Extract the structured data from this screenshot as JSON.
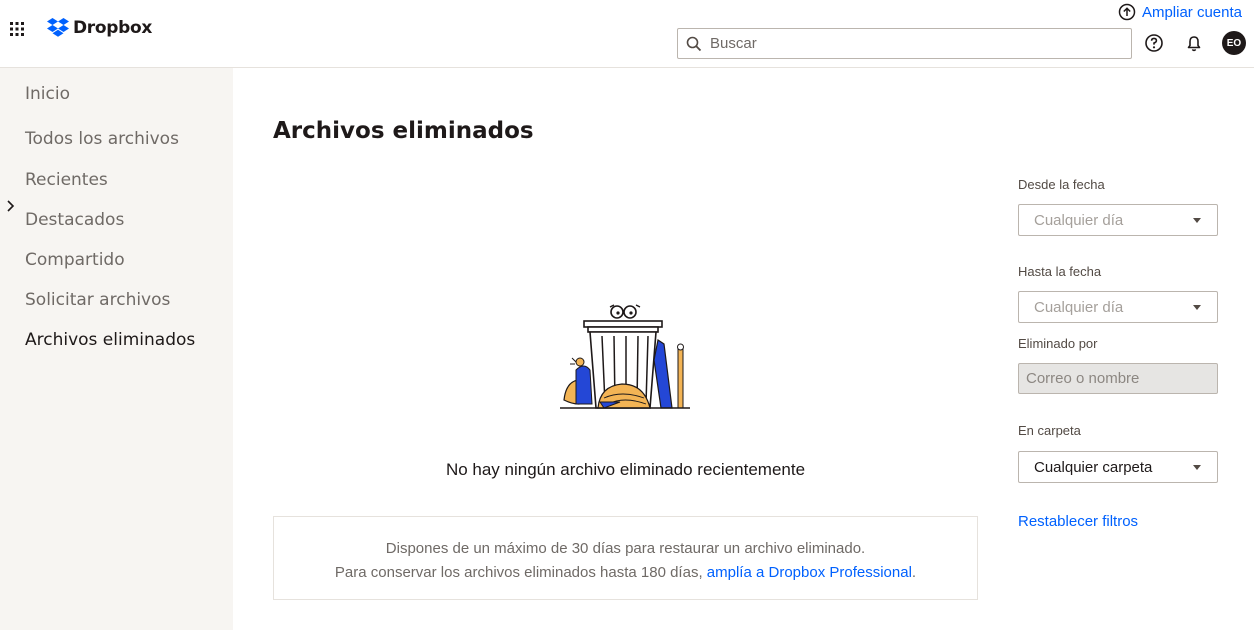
{
  "header": {
    "brand": "Dropbox",
    "upgrade_label": "Ampliar cuenta",
    "search_placeholder": "Buscar",
    "avatar_initials": "EO",
    "icons": [
      "app-grid-icon",
      "dropbox-logo-icon",
      "upgrade-arrow-icon",
      "search-icon",
      "help-icon",
      "bell-icon"
    ]
  },
  "sidebar": {
    "items": [
      {
        "label": "Inicio"
      },
      {
        "label": "Todos los archivos"
      },
      {
        "label": "Recientes"
      },
      {
        "label": "Destacados"
      },
      {
        "label": "Compartido"
      },
      {
        "label": "Solicitar archivos"
      },
      {
        "label": "Archivos eliminados"
      }
    ],
    "active_item": "Archivos eliminados"
  },
  "main": {
    "title": "Archivos eliminados",
    "empty_message": "No hay ningún archivo eliminado recientemente",
    "info_line1": "Dispones de un máximo de 30 días para restaurar un archivo eliminado.",
    "info_line2": "Para conservar los archivos eliminados hasta 180 días,",
    "info_link": "amplía a Dropbox Professional",
    "info_suffix": "."
  },
  "filters": {
    "from_label": "Desde la fecha",
    "from_value": "Cualquier día",
    "to_label": "Hasta la fecha",
    "to_value": "Cualquier día",
    "deleted_by_label": "Eliminado por",
    "deleted_by_placeholder": "Correo o nombre",
    "folder_label": "En carpeta",
    "folder_value": "Cualquier carpeta",
    "reset_label": "Restablecer filtros"
  },
  "colors": {
    "accent": "#0061fe",
    "sidebar_bg": "#f7f5f2",
    "text": "#1e1919",
    "illustration_blue": "#2447d6",
    "illustration_orange": "#f3b455"
  }
}
